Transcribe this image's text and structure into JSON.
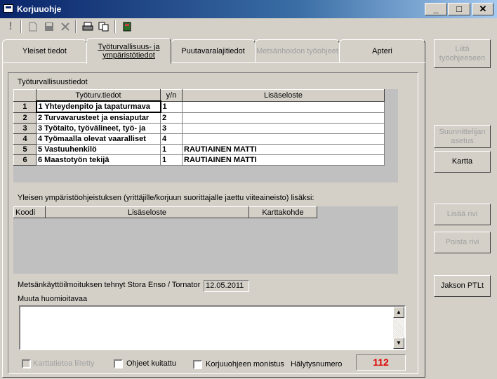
{
  "window": {
    "title": "Korjuuohje",
    "min": "_",
    "max": "□",
    "close": "✕"
  },
  "toolbar": {
    "icons": [
      "exclamation-icon",
      "new-document-icon",
      "save-icon",
      "delete-icon",
      "print-icon",
      "copy-icon",
      "book-icon"
    ]
  },
  "tabs": [
    {
      "label": "Yleiset tiedot",
      "state": "normal"
    },
    {
      "label": "Työturvallisuus- ja ympäristötiedot",
      "state": "active"
    },
    {
      "label": "Puutavaralajitiedot",
      "state": "normal"
    },
    {
      "label": "Metsänhoidon työohjeet",
      "state": "disabled"
    },
    {
      "label": "Apteri",
      "state": "normal"
    }
  ],
  "safety": {
    "section_label": "Työturvallisuustiedot",
    "columns": [
      "Työturv.tiedot",
      "y/n",
      "Lisäseloste"
    ],
    "rows": [
      {
        "num": "1",
        "tiedot": "1 Yhteydenpito ja tapaturmava",
        "yn": "1",
        "lisa": ""
      },
      {
        "num": "2",
        "tiedot": "2 Turvavarusteet ja ensiaputar",
        "yn": "2",
        "lisa": ""
      },
      {
        "num": "3",
        "tiedot": "3 Työtaito, työvälineet, työ- ja",
        "yn": "3",
        "lisa": ""
      },
      {
        "num": "4",
        "tiedot": "4 Työmaalla olevat vaaralliset",
        "yn": "4",
        "lisa": ""
      },
      {
        "num": "5",
        "tiedot": "5 Vastuuhenkilö",
        "yn": "1",
        "lisa": "RAUTIAINEN MATTI"
      },
      {
        "num": "6",
        "tiedot": "6 Maastotyön tekijä",
        "yn": "1",
        "lisa": "RAUTIAINEN MATTI"
      }
    ]
  },
  "environment": {
    "label": "Yleisen ympäristöohjeistuksen (yrittäjille/korjuun suorittajalle jaettu viiteaineisto) lisäksi:",
    "columns": [
      "Koodi",
      "Lisäseloste",
      "Karttakohde"
    ]
  },
  "notice": {
    "label": "Metsänkäyttöilmoituksen tehnyt Stora Enso / Tornator",
    "date": "12.05.2011"
  },
  "notes": {
    "label": "Muuta huomioitavaa",
    "value": ""
  },
  "footer": {
    "map_attached": "Karttatietoa liitetty",
    "instructions_ack": "Ohjeet kuitattu",
    "copy_label": "Korjuuohjeen monistus",
    "alarm_label": "Hälytysnumero",
    "alarm_number": "112",
    "alarm_color": "#e00000"
  },
  "side_buttons": {
    "attach": "Liitä työohjeeseen",
    "planner": "Suunnittelijan asetus",
    "map": "Kartta",
    "add_row": "Lisää rivi",
    "remove_row": "Poista rivi",
    "distribute": "Jakson PTLt"
  }
}
